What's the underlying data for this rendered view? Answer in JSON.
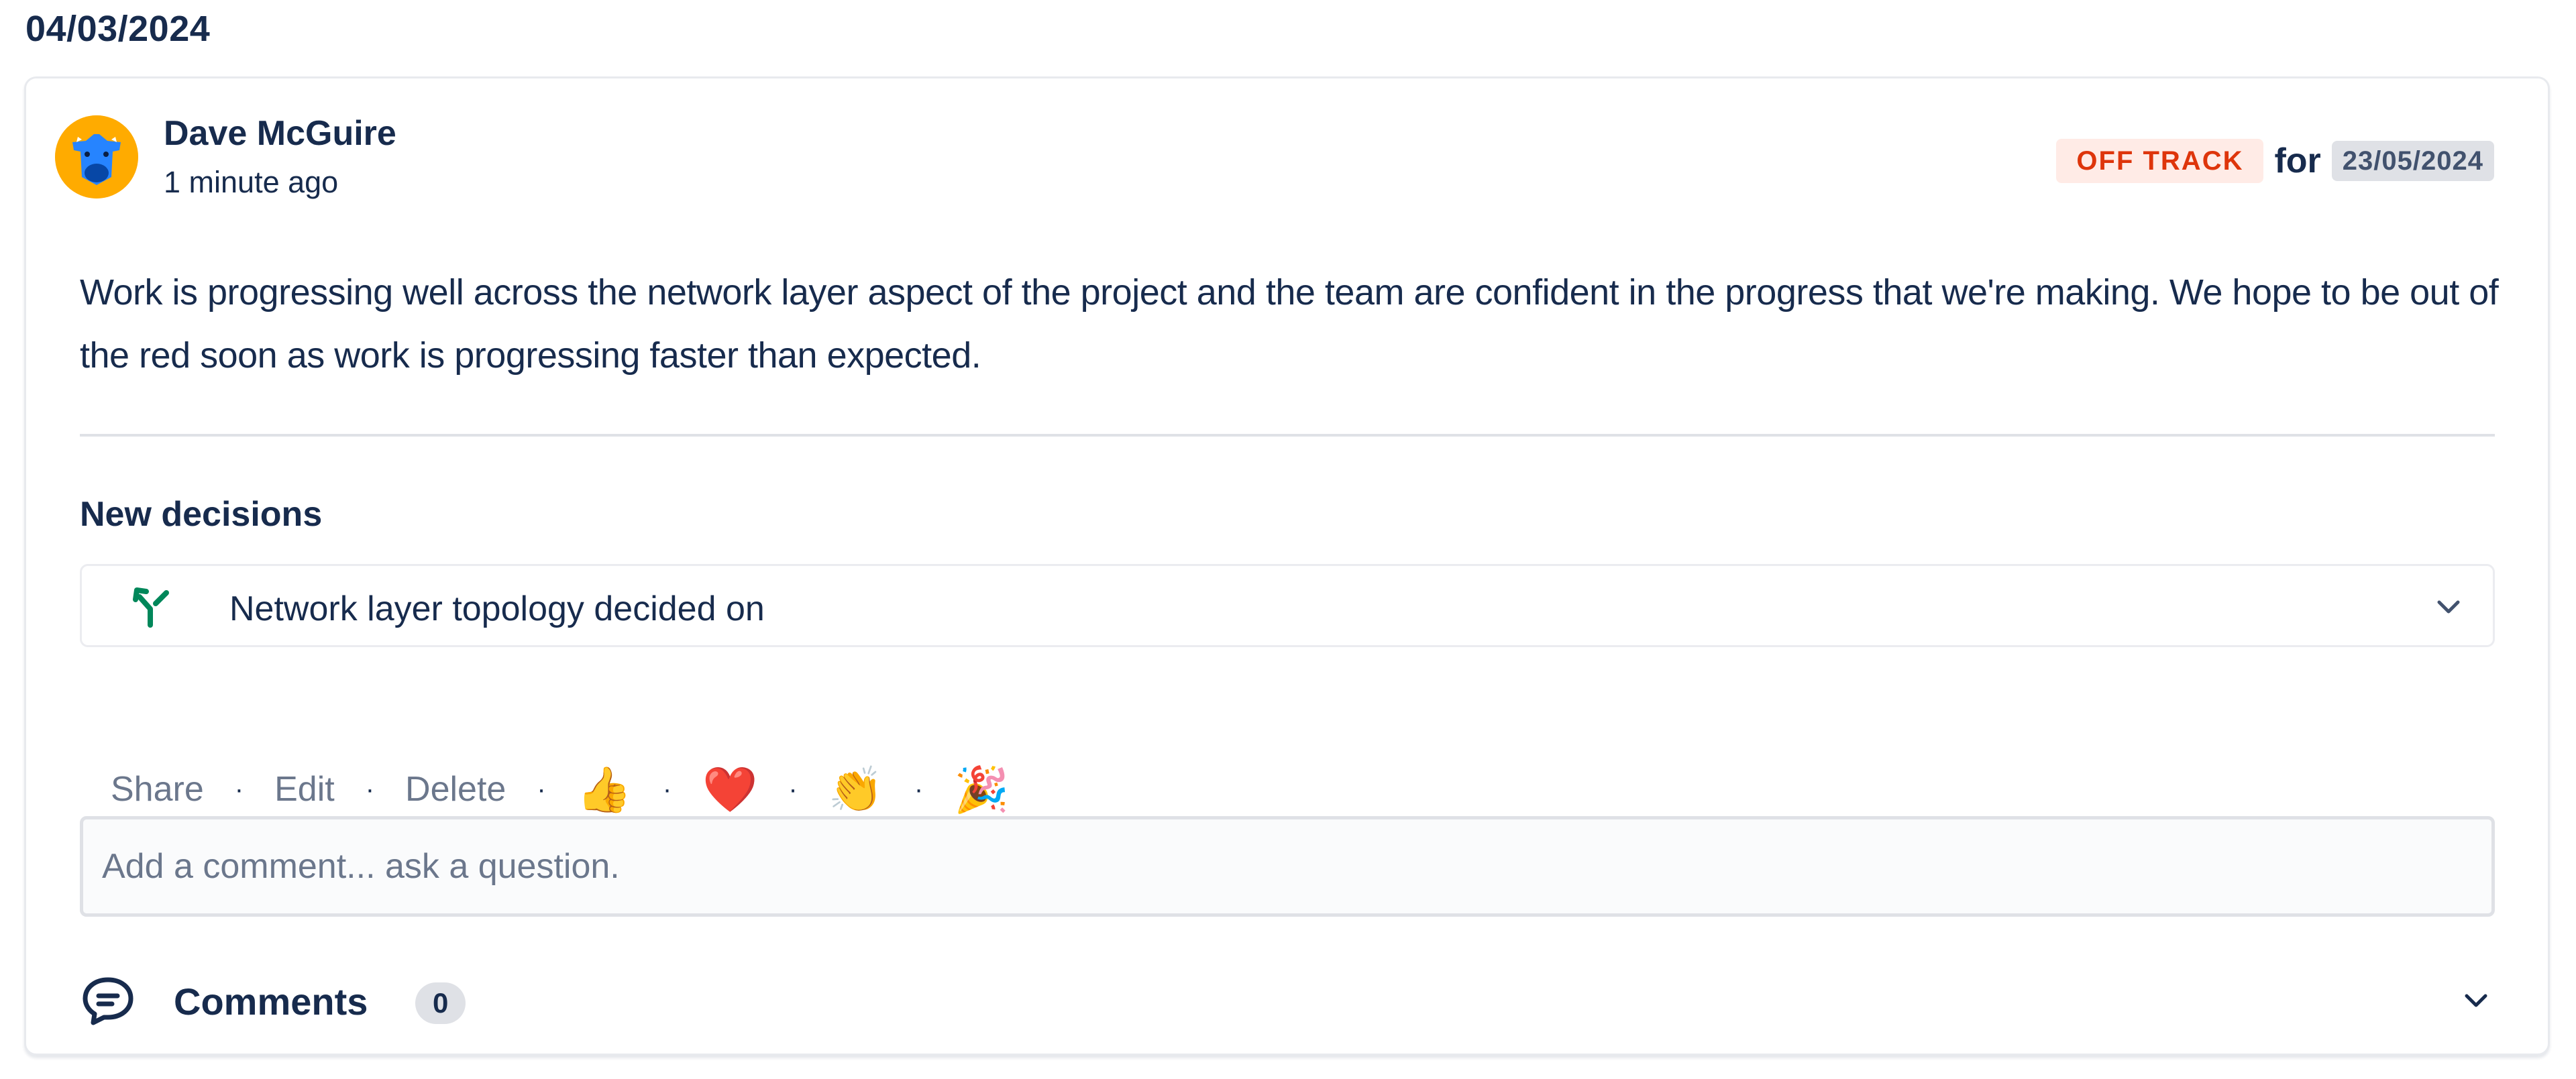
{
  "update": {
    "date": "04/03/2024",
    "author": {
      "name": "Dave McGuire",
      "time_ago": "1 minute ago"
    },
    "status": {
      "label": "OFF TRACK",
      "for_word": "for",
      "target_date": "23/05/2024"
    },
    "body": "Work is progressing well across the network layer aspect of the project and the team are confident in the progress that we're making. We hope to be out of the red soon as work is progressing faster than expected."
  },
  "decisions": {
    "title": "New decisions",
    "items": [
      {
        "label": "Network layer topology decided on",
        "icon": "decision-branch-icon"
      }
    ]
  },
  "actions": {
    "share": "Share",
    "edit": "Edit",
    "delete": "Delete",
    "separator": "·",
    "reactions": [
      "👍",
      "❤️",
      "👏",
      "🎉"
    ]
  },
  "comment": {
    "placeholder": "Add a comment... ask a question."
  },
  "comments": {
    "label": "Comments",
    "count": "0"
  },
  "colors": {
    "off_track_bg": "#ffebe6",
    "off_track_text": "#de350b",
    "avatar_bg": "#ffab00",
    "decision_icon": "#00875a",
    "muted_text": "#6b778c"
  }
}
